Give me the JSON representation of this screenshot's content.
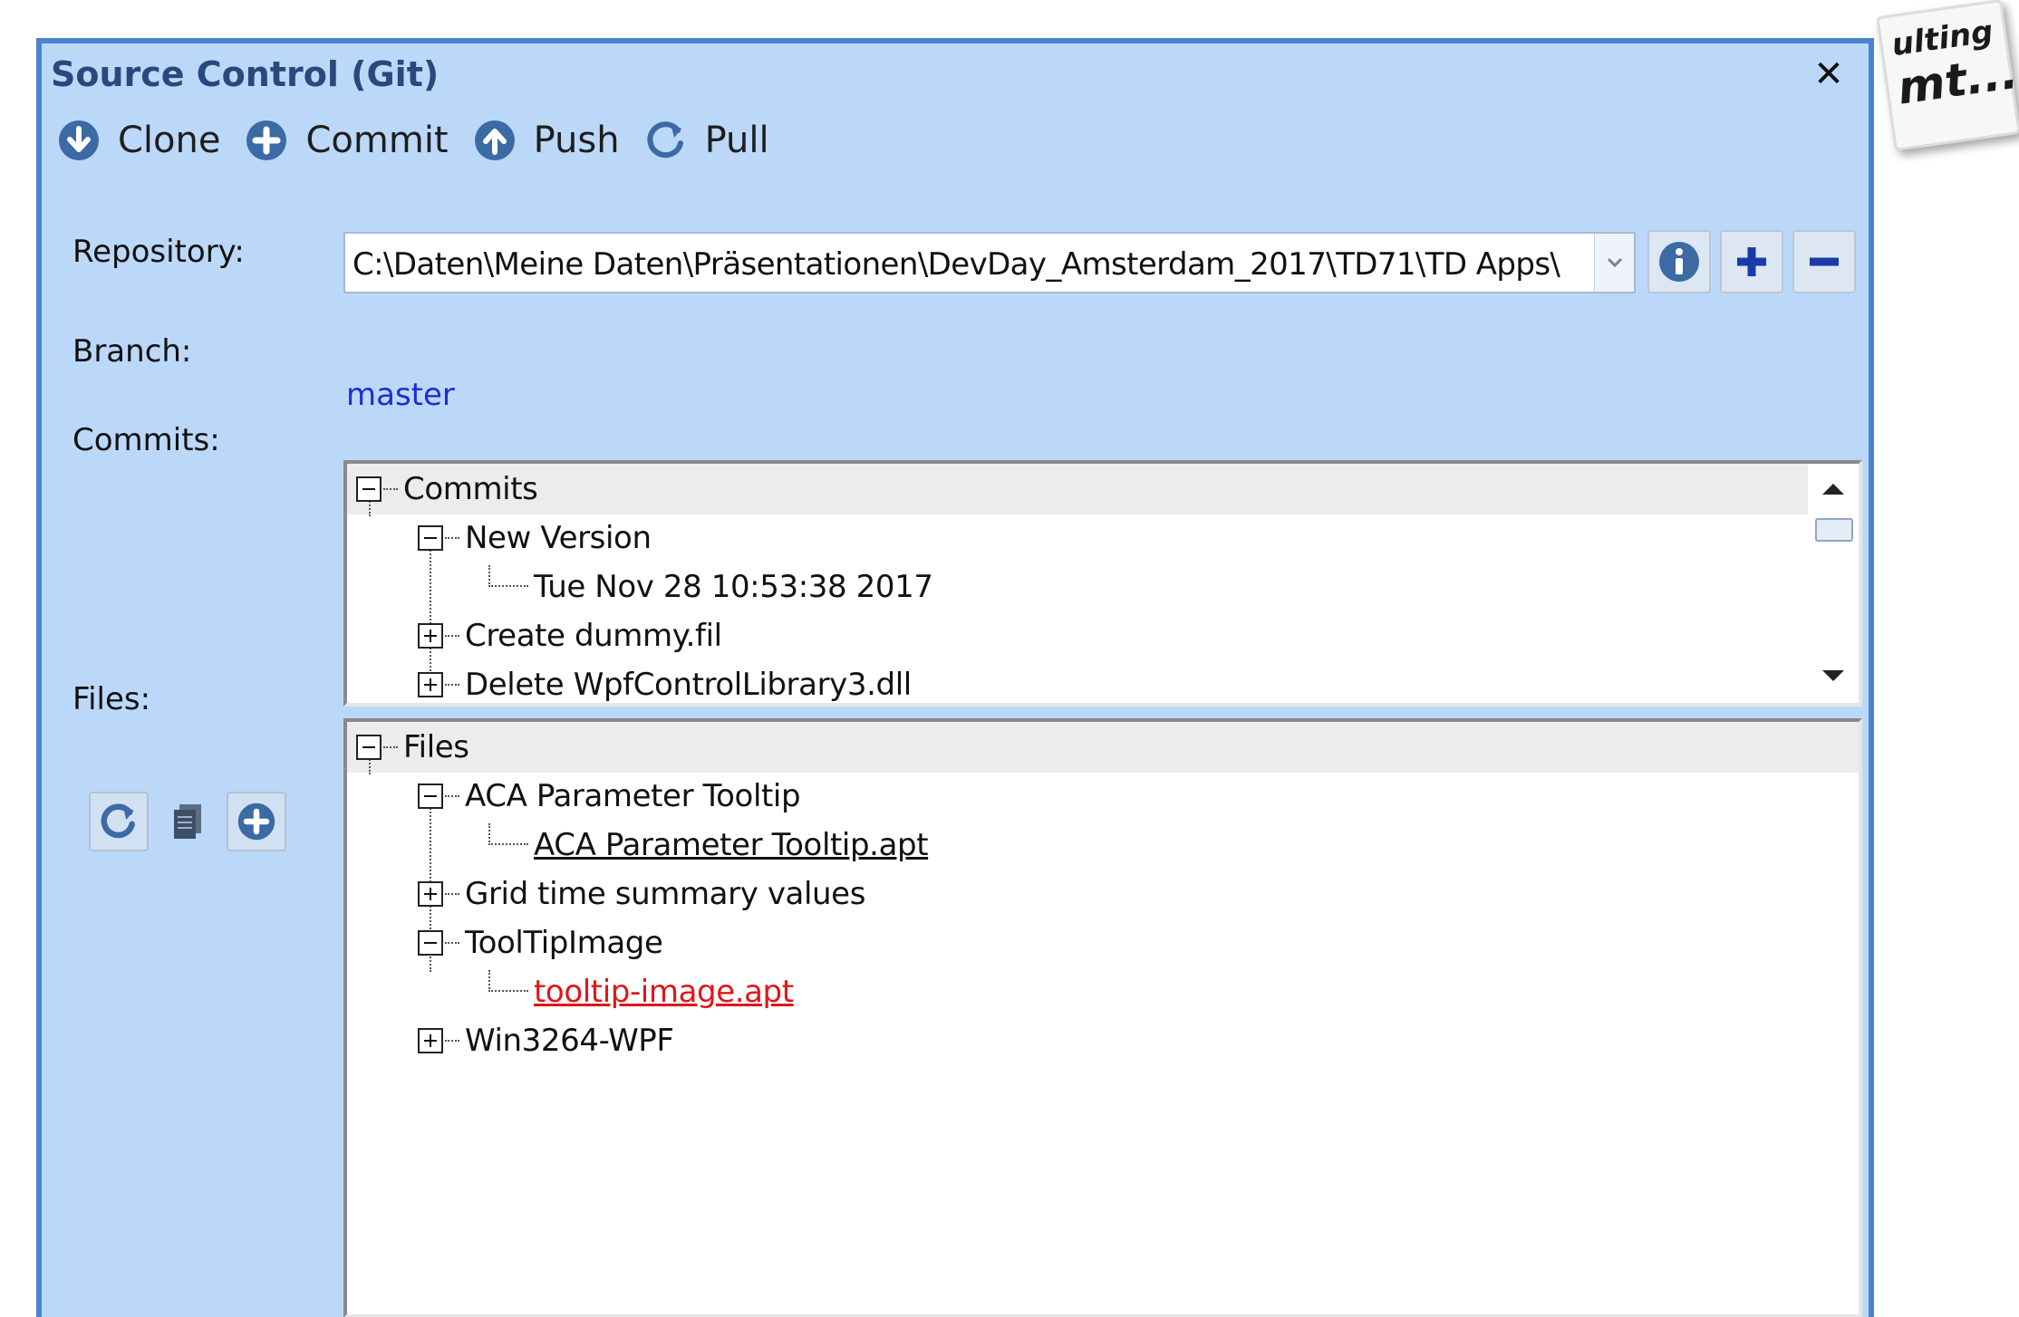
{
  "window": {
    "title": "Source Control (Git)",
    "close_label": "✕"
  },
  "toolbar": {
    "items": [
      {
        "label": "Clone",
        "icon": "download-circle-icon"
      },
      {
        "label": "Commit",
        "icon": "plus-circle-icon"
      },
      {
        "label": "Push",
        "icon": "upload-circle-icon"
      },
      {
        "label": "Pull",
        "icon": "refresh-icon"
      }
    ]
  },
  "form": {
    "repository_label": "Repository:",
    "repository_value": "C:\\Daten\\Meine Daten\\Präsentationen\\DevDay_Amsterdam_2017\\TD71\\TD Apps\\",
    "branch_label": "Branch:",
    "branch_value": "master",
    "commits_label": "Commits:",
    "files_label": "Files:"
  },
  "repo_buttons": [
    {
      "icon": "info-icon"
    },
    {
      "icon": "plus-icon"
    },
    {
      "icon": "minus-icon"
    }
  ],
  "commits_tree": {
    "root": "Commits",
    "nodes": [
      {
        "label": "New Version",
        "expanded": true,
        "children": [
          "Tue Nov 28 10:53:38 2017"
        ]
      },
      {
        "label": "Create dummy.fil",
        "expanded": false
      },
      {
        "label": "Delete WpfControlLibrary3.dll",
        "expanded": false
      }
    ]
  },
  "files_tree": {
    "root": "Files",
    "nodes": [
      {
        "label": "ACA Parameter Tooltip",
        "expanded": true,
        "children": [
          "ACA Parameter Tooltip.apt"
        ]
      },
      {
        "label": "Grid time summary values",
        "expanded": false
      },
      {
        "label": "ToolTipImage",
        "expanded": true,
        "children": [
          "tooltip-image.apt"
        ]
      },
      {
        "label": "Win3264-WPF",
        "expanded": false
      }
    ]
  },
  "files_buttons": [
    {
      "icon": "refresh-icon"
    },
    {
      "icon": "copy-icon"
    },
    {
      "icon": "plus-circle-icon"
    }
  ],
  "logo": {
    "line1": "ulting",
    "line2": "mt..."
  },
  "colors": {
    "window_bg": "#bcd8f9",
    "window_border": "#4b84cf",
    "title_text": "#27497d",
    "branch_link": "#1f2bd6",
    "modified_file": "#e0161a",
    "icon_blue": "#3b6aa5"
  }
}
